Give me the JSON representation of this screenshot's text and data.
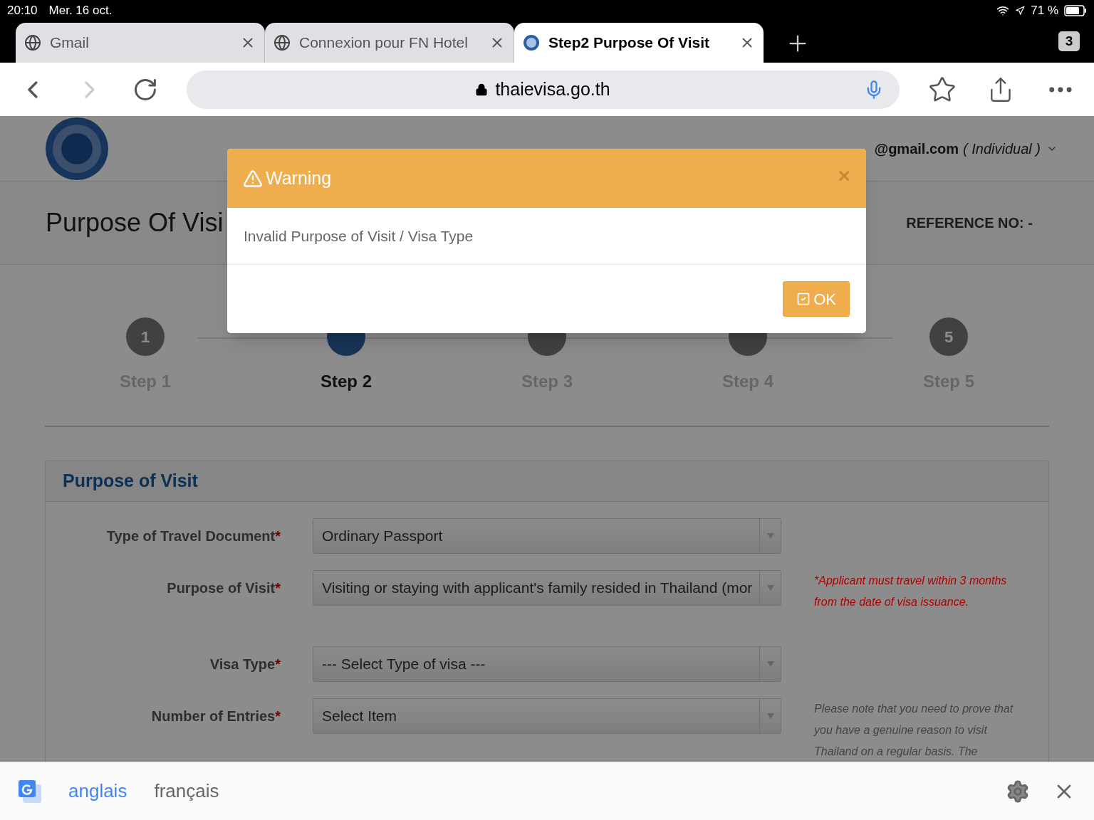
{
  "status_bar": {
    "time": "20:10",
    "date": "Mer. 16 oct.",
    "battery": "71 %"
  },
  "browser_tabs": [
    {
      "title": "Gmail",
      "selected": false
    },
    {
      "title": "Connexion pour FN Hotel",
      "selected": false
    },
    {
      "title": "Step2 Purpose Of Visit",
      "selected": true
    }
  ],
  "tab_count": "3",
  "address_bar": {
    "url": "thaievisa.go.th"
  },
  "page": {
    "user": "@gmail.com",
    "account_type": "( Individual )",
    "title": "Purpose Of Visi",
    "reference": "REFERENCE NO: -",
    "steps": [
      {
        "number": "1",
        "label": "Step 1",
        "selected": false
      },
      {
        "label": "Step 2",
        "selected": true
      },
      {
        "label": "Step 3",
        "selected": false
      },
      {
        "label": "Step 4",
        "selected": false
      },
      {
        "number": "5",
        "label": "Step 5",
        "selected": false
      }
    ],
    "panel_title": "Purpose of Visit",
    "fields": [
      {
        "label": "Type of Travel Document",
        "required": "*",
        "value": "Ordinary Passport"
      },
      {
        "label": "Purpose of Visit",
        "required": "*",
        "value": "Visiting or staying with applicant's family resided in Thailand (mor",
        "note": {
          "text": "*Applicant must travel within 3 months from the date of visa issuance.",
          "color": "#b00000"
        }
      },
      {
        "label": "Visa Type",
        "required": "*",
        "value": "--- Select Type of visa ---"
      },
      {
        "label": "Number of Entries",
        "required": "*",
        "value": "Select Item",
        "note": {
          "text": "Please note that you need to prove that you have a genuine reason to visit Thailand on a regular basis. The",
          "color": "#444444"
        }
      }
    ]
  },
  "dialog": {
    "title": "Warning",
    "close": "×",
    "message": "Invalid Purpose of Visit / Visa Type",
    "button": "OK"
  },
  "translate_bar": {
    "languages": [
      {
        "label": "anglais",
        "selected": true
      },
      {
        "label": "français",
        "selected": false
      }
    ]
  }
}
